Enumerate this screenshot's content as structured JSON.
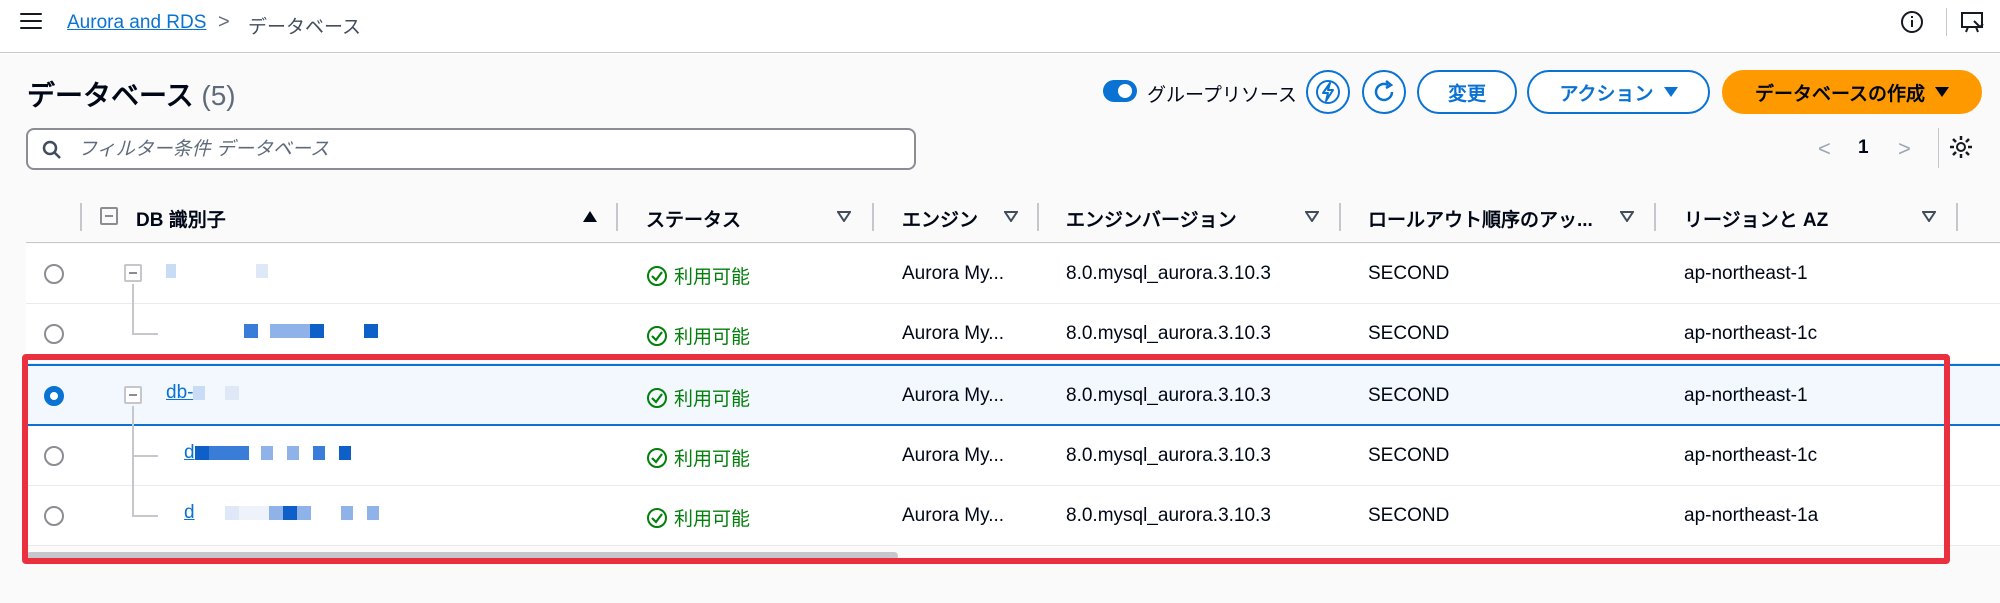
{
  "breadcrumb": {
    "service": "Aurora and RDS",
    "separator": ">",
    "current": "データベース"
  },
  "header": {
    "title": "データベース",
    "count": "(5)"
  },
  "toolbar": {
    "group_toggle_label": "グループリソース",
    "group_toggle_on": true,
    "modify_label": "変更",
    "actions_label": "アクション",
    "create_label": "データベースの作成"
  },
  "search": {
    "placeholder": "フィルター条件 データベース",
    "value": ""
  },
  "pagination": {
    "prev": "<",
    "page": "1",
    "next": ">"
  },
  "table": {
    "columns": [
      "DB 識別子",
      "ステータス",
      "エンジン",
      "エンジンバージョン",
      "ロールアウト順序のアッ...",
      "リージョンと AZ"
    ],
    "rows": [
      {
        "id": "",
        "status": "利用可能",
        "engine": "Aurora My...",
        "version": "8.0.mysql_aurora.3.10.3",
        "rollout": "SECOND",
        "region": "ap-northeast-1",
        "selected": false
      },
      {
        "id": "",
        "status": "利用可能",
        "engine": "Aurora My...",
        "version": "8.0.mysql_aurora.3.10.3",
        "rollout": "SECOND",
        "region": "ap-northeast-1c",
        "selected": false
      },
      {
        "id": "db-",
        "status": "利用可能",
        "engine": "Aurora My...",
        "version": "8.0.mysql_aurora.3.10.3",
        "rollout": "SECOND",
        "region": "ap-northeast-1",
        "selected": true
      },
      {
        "id": "d",
        "status": "利用可能",
        "engine": "Aurora My...",
        "version": "8.0.mysql_aurora.3.10.3",
        "rollout": "SECOND",
        "region": "ap-northeast-1c",
        "selected": false
      },
      {
        "id": "d",
        "status": "利用可能",
        "engine": "Aurora My...",
        "version": "8.0.mysql_aurora.3.10.3",
        "rollout": "SECOND",
        "region": "ap-northeast-1a",
        "selected": false
      }
    ]
  },
  "colors": {
    "accent": "#0972d3",
    "primary_button": "#ff9900",
    "available": "#037f0c",
    "highlight": "#ea2f3f"
  }
}
